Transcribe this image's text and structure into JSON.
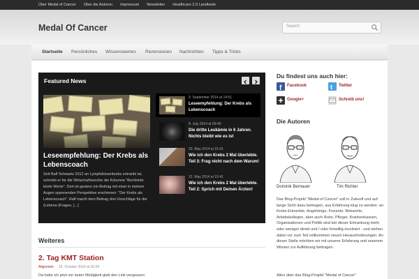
{
  "topnav": [
    "Über Medal of Cancer",
    "Über die Autoren",
    "Impressum",
    "Newsletter",
    "Healthcare 2.0 Landkarte"
  ],
  "header": {
    "title": "Medal Of Cancer"
  },
  "search": {
    "placeholder": "Search"
  },
  "mainnav": [
    "Startseite",
    "Persönliches",
    "Wissenswertes",
    "Rezensionen",
    "Nachrichten",
    "Tipps & Tricks"
  ],
  "featured": {
    "heading": "Featured News",
    "main_title": "Leseempfehlung: Der Krebs als Lebenscoach",
    "main_excerpt": "Seit Ralf Schwartz 2012 an Lymphdrüsenkrebs erkrankt ist, schreibt er für die Wirtschaftswoche die Kolumne \"Berühmte letzte Worte\". Dort ist gestern ein Beitrag mit einer in meinen Augen spannenden Perspektive erschienen: \"Der Krebs als Lebenscoach\". Ralf macht dem Beitrag drei Vorschläge für die (Lebens-)Fragen, [...]",
    "items": [
      {
        "date": "9. September 2014 at 14:51",
        "title": "Leseempfehlung: Der Krebs als Lebenscoach"
      },
      {
        "date": "8. July 2014 at 09:49",
        "title": "Die dritte Leukämie in 6 Jahren. Nichts bleibt wie es ist"
      },
      {
        "date": "20. May 2014 at 15:41",
        "title": "Wie ich den Krebs 2 Mal überlebte. Teil 3: Frag nicht nach dem Warum!"
      },
      {
        "date": "12. May 2014 at 15:41",
        "title": "Wie ich den Krebs 2 Mal überlebte. Teil 2: Sprich mit Deinen Ärzten!"
      }
    ]
  },
  "weiteres": {
    "heading": "Weiteres",
    "post_title": "2. Tag KMT Station",
    "post_category": "Allgemein",
    "post_date": "15. October 2014 at 20:29",
    "post_excerpt": "Da habe ich jetzt vor lauter Müdigkeit glatt den Link vergessen:"
  },
  "sidebar": {
    "find_heading": "Du findest uns auch hier:",
    "social": [
      {
        "label": "Facebook",
        "color": "#3b5998"
      },
      {
        "label": "Twitter",
        "color": "#4aa3df"
      },
      {
        "label": "Google+",
        "color": "#333333"
      },
      {
        "label": "Schreib uns!",
        "color": "#d8d8d8"
      }
    ],
    "authors_heading": "Die Autoren",
    "authors": [
      "Dominik Bernauer",
      "Tim Richter"
    ],
    "about_text": "Das Blog-Projekt \"Medal of Cancer\" soll in Zukunft und auf lange Sicht dazu beitragen, aus Erfahrung klug zu werden: an Krebs Erkrankte, Angehörige, Freunde, Bekannte, Arbeitskollegen, aber auch Ärzte, Pfleger, Krankenkassen, Organisationen und Politik sind bei dieser Erkrankung mehr oder weniger direkt und / oder freiwillig involviert - und stehen dabei vor zum Teil vollkommen neuen Herausforderungen. An dieser Stelle möchten wir mit unserer Erfahrung und unserem Wissen zur Aufklärung beitragen.",
    "about_text_2": "Alles über das Blog-Projekt \"Medal of Cancer\""
  },
  "colors": {
    "accent": "#9e1f1f",
    "featured_bg": "#1a1a1a"
  }
}
